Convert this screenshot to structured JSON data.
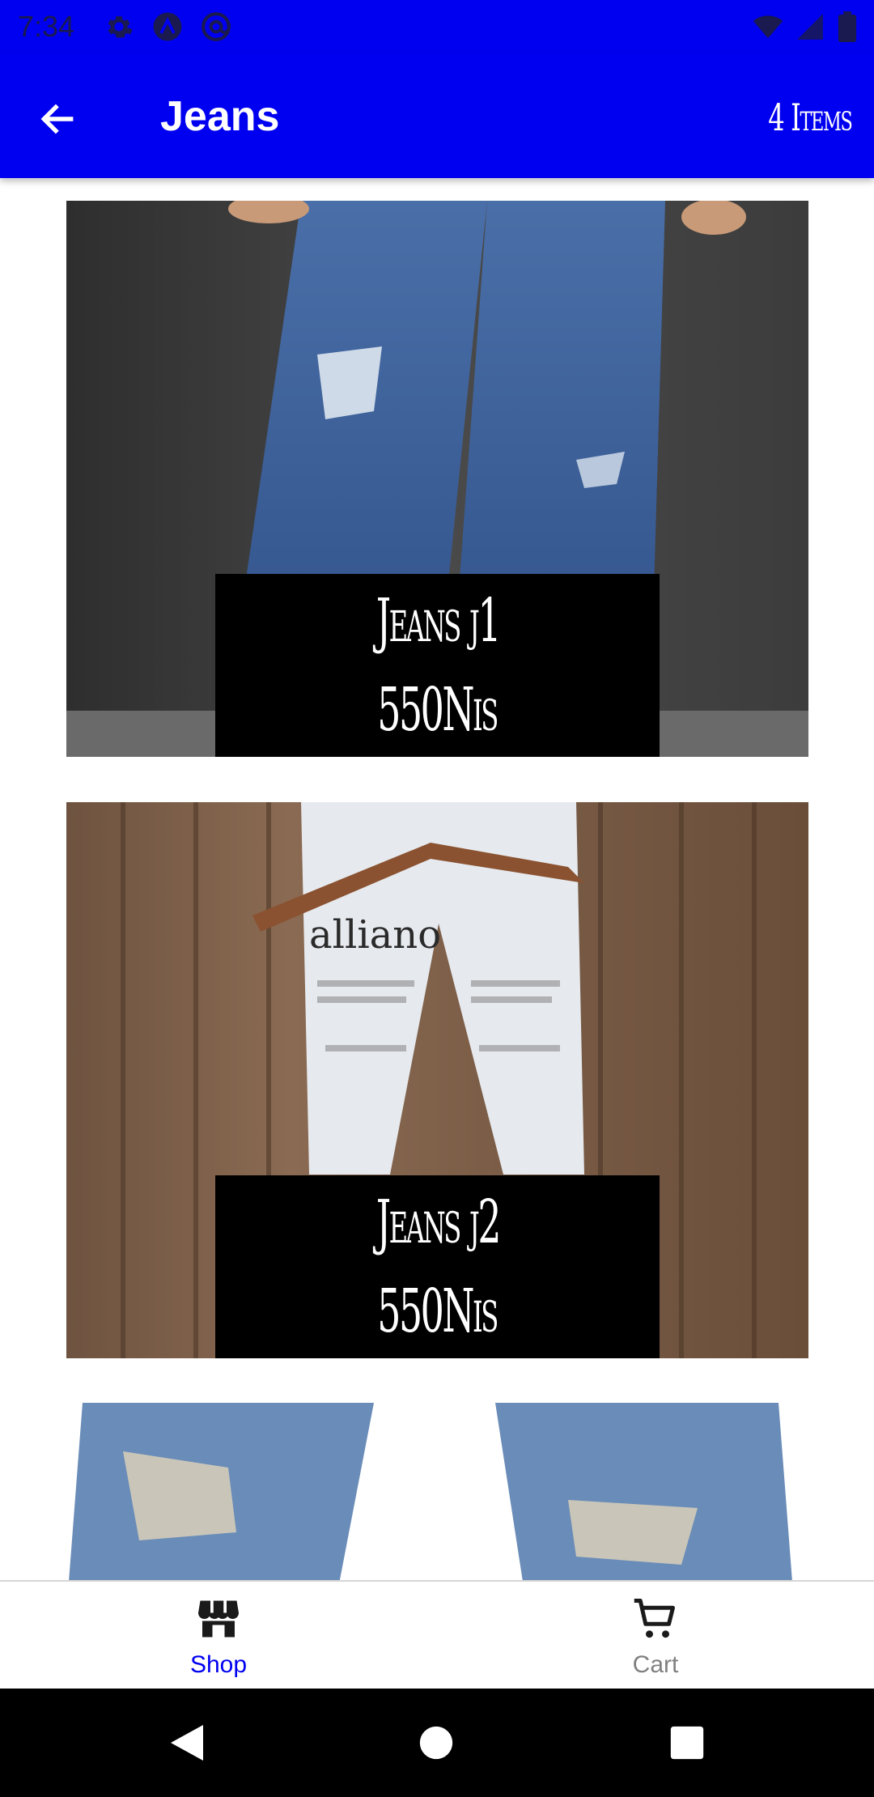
{
  "status_bar": {
    "time": "7:34",
    "left_icons": [
      "settings-icon",
      "signal-a-icon",
      "at-sign-icon"
    ],
    "right_icons": [
      "wifi-icon",
      "cell-signal-icon",
      "battery-icon"
    ]
  },
  "app_bar": {
    "title": "Jeans",
    "item_count": "4 Items",
    "back_icon": "arrow-left-icon",
    "color": "#0000F0"
  },
  "products": [
    {
      "name": "Jeans j1",
      "price": "550Nis"
    },
    {
      "name": "Jeans j2",
      "price": "550Nis"
    }
  ],
  "bottom_nav": {
    "items": [
      {
        "label": "Shop",
        "icon": "store-icon",
        "active": true
      },
      {
        "label": "Cart",
        "icon": "cart-icon",
        "active": false
      }
    ],
    "active_color": "#0000F0",
    "inactive_color": "#808080"
  },
  "system_nav": [
    "back-triangle-icon",
    "home-circle-icon",
    "recents-square-icon"
  ]
}
